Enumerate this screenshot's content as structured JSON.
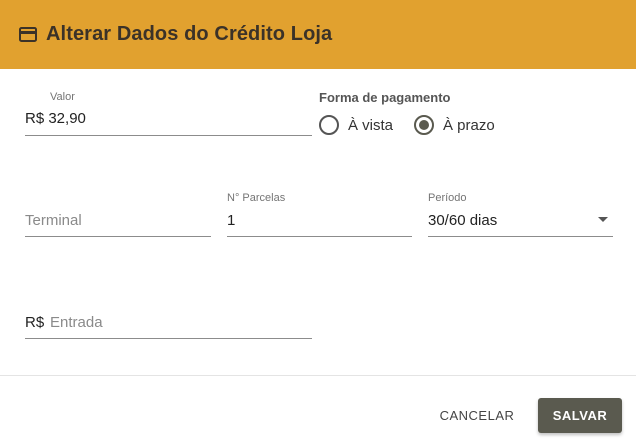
{
  "dialog": {
    "title": "Alterar Dados do Crédito Loja",
    "header_color": "#e1a12f",
    "header_icon": "credit-card-icon"
  },
  "form": {
    "valor": {
      "label": "Valor",
      "value": "R$ 32,90"
    },
    "forma_pagamento": {
      "label": "Forma de pagamento",
      "options": [
        {
          "label": "À vista",
          "checked": false
        },
        {
          "label": "À prazo",
          "checked": true
        }
      ]
    },
    "terminal": {
      "placeholder": "Terminal"
    },
    "parcelas": {
      "label": "N° Parcelas",
      "value": "1"
    },
    "periodo": {
      "label": "Período",
      "value": "30/60 dias"
    },
    "entrada": {
      "prefix": "R$",
      "placeholder": "Entrada"
    }
  },
  "actions": {
    "cancel_label": "CANCELAR",
    "save_label": "SALVAR",
    "save_color": "#5a5a4f"
  }
}
